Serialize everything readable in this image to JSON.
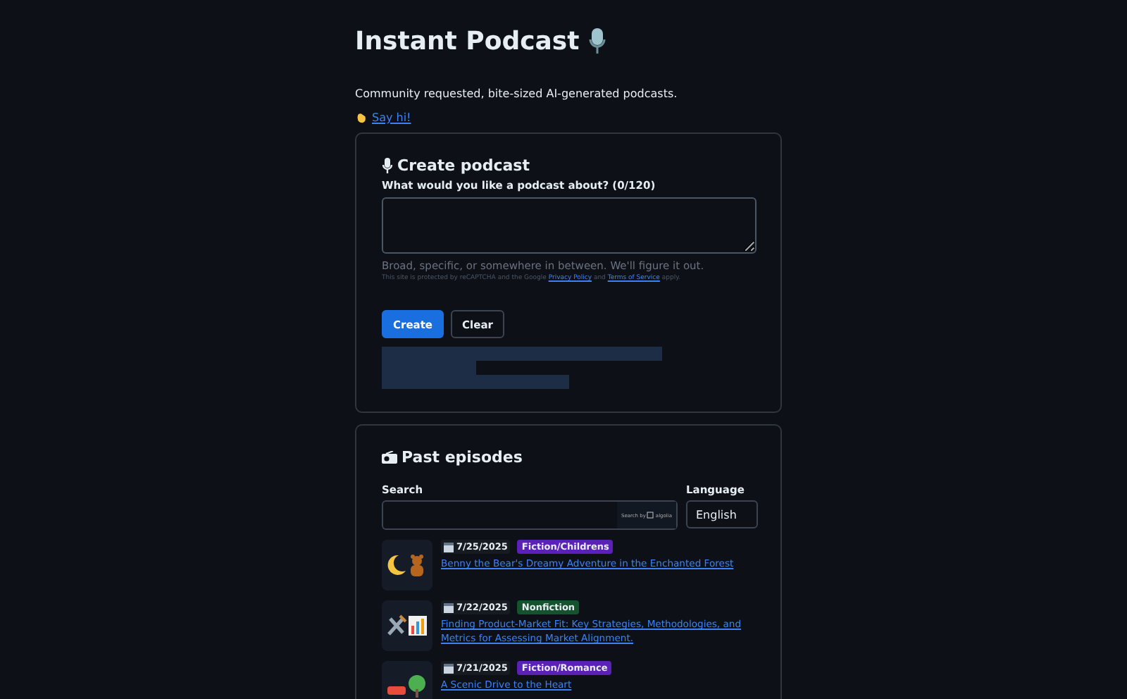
{
  "title": "Instant Podcast",
  "tagline": "Community requested, bite-sized AI-generated podcasts.",
  "say_hi_link": "Say hi!",
  "create": {
    "heading": "Create podcast",
    "label": "What would you like a podcast about? (0/120)",
    "hint": "Broad, specific, or somewhere in between. We'll figure it out.",
    "recaptcha": {
      "before": "This site is protected by reCAPTCHA and the Google",
      "privacy_link": "Privacy Policy",
      "middle": "and",
      "terms_link": "Terms of Service",
      "after": "apply."
    },
    "buttons": [
      {
        "label": "Create",
        "kind": "primary"
      },
      {
        "label": "Clear",
        "kind": "secondary"
      }
    ]
  },
  "past": {
    "heading": "Past episodes",
    "search_label": "Search",
    "search_badge": "Search by",
    "search_brand": "algolia",
    "language_label": "Language",
    "language_value": "English",
    "episodes": [
      {
        "date": "7/25/2025",
        "category": "Fiction/Childrens",
        "color": "#5b21b6",
        "title": "Benny the Bear's Dreamy Adventure in the Enchanted Forest"
      },
      {
        "date": "7/22/2025",
        "category": "Nonfiction",
        "color": "#14532d",
        "title": "Finding Product-Market Fit: Key Strategies, Methodologies, and Metrics for Assessing Market Alignment."
      },
      {
        "date": "7/21/2025",
        "category": "Fiction/Romance",
        "color": "#5b21b6",
        "title": "A Scenic Drive to the Heart"
      }
    ]
  }
}
